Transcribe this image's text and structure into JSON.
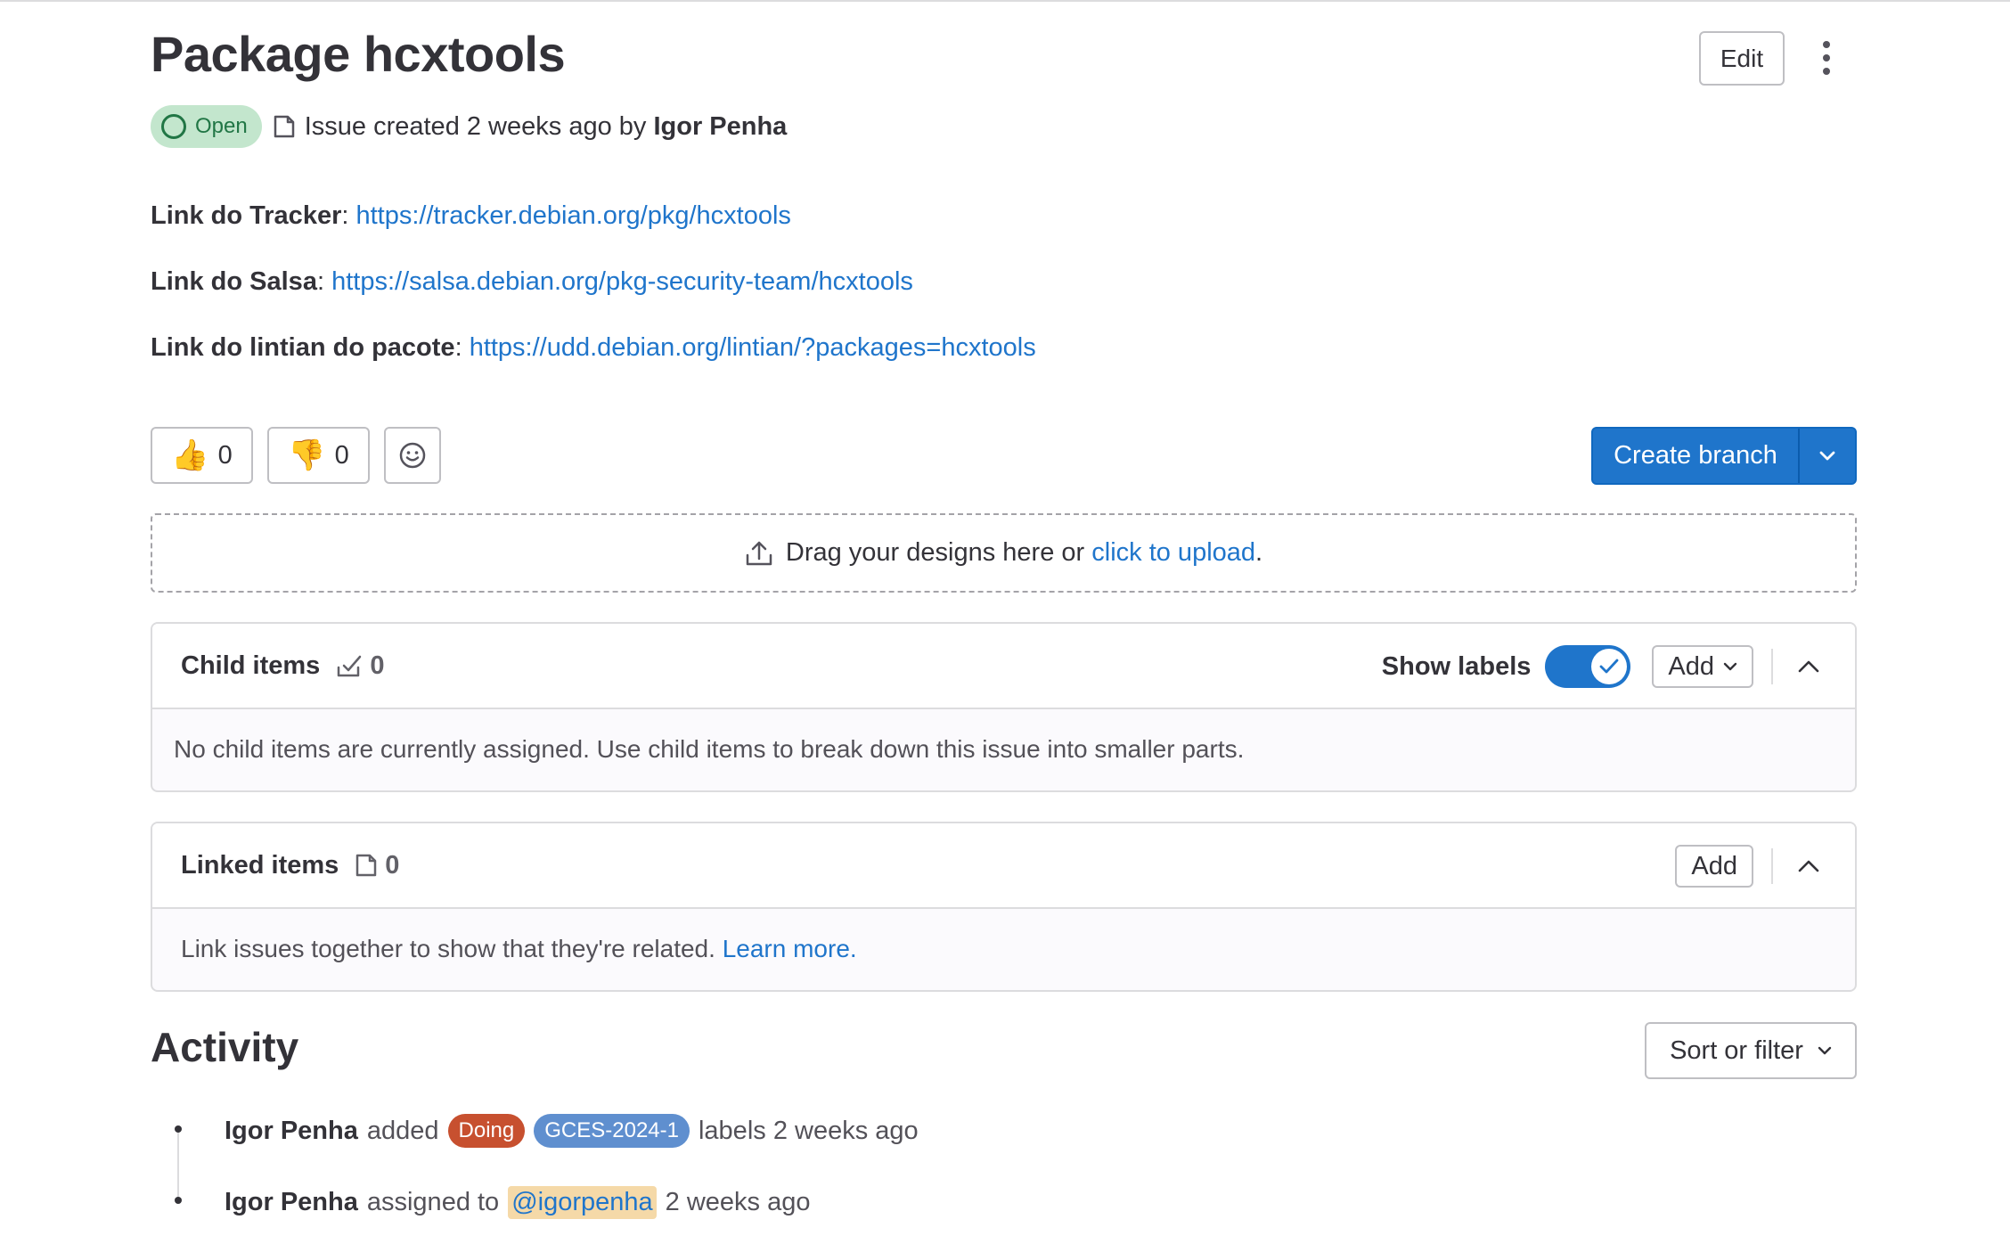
{
  "header": {
    "title": "Package hcxtools",
    "edit_label": "Edit"
  },
  "meta": {
    "status": "Open",
    "created_text": "Issue created 2 weeks ago by",
    "author": "Igor Penha"
  },
  "description": {
    "lines": [
      {
        "label": "Link do Tracker",
        "url": "https://tracker.debian.org/pkg/hcxtools"
      },
      {
        "label": "Link do Salsa",
        "url": "https://salsa.debian.org/pkg-security-team/hcxtools"
      },
      {
        "label": "Link do lintian do pacote",
        "url": "https://udd.debian.org/lintian/?packages=hcxtools"
      }
    ]
  },
  "reactions": {
    "thumbs_up_count": "0",
    "thumbs_down_count": "0"
  },
  "create_branch_label": "Create branch",
  "dropzone": {
    "text": "Drag your designs here or",
    "link": "click to upload",
    "suffix": "."
  },
  "child_items": {
    "title": "Child items",
    "count": "0",
    "show_labels": "Show labels",
    "add_label": "Add",
    "empty_text": "No child items are currently assigned. Use child items to break down this issue into smaller parts."
  },
  "linked_items": {
    "title": "Linked items",
    "count": "0",
    "add_label": "Add",
    "empty_text": "Link issues together to show that they're related.",
    "learn_more": "Learn more."
  },
  "activity": {
    "title": "Activity",
    "sort_label": "Sort or filter",
    "events": [
      {
        "author": "Igor Penha",
        "action": "added",
        "labels": [
          {
            "name": "Doing",
            "color": "#c7502f"
          },
          {
            "name": "GCES-2024-1",
            "color": "#5f8fcf"
          }
        ],
        "suffix": "labels 2 weeks ago"
      },
      {
        "author": "Igor Penha",
        "action": "assigned to",
        "mention": "@igorpenha",
        "suffix": "2 weeks ago"
      }
    ]
  },
  "colors": {
    "primary": "#1f75cb",
    "open_badge_bg": "#c3e6cd",
    "open_badge_fg": "#217645"
  }
}
